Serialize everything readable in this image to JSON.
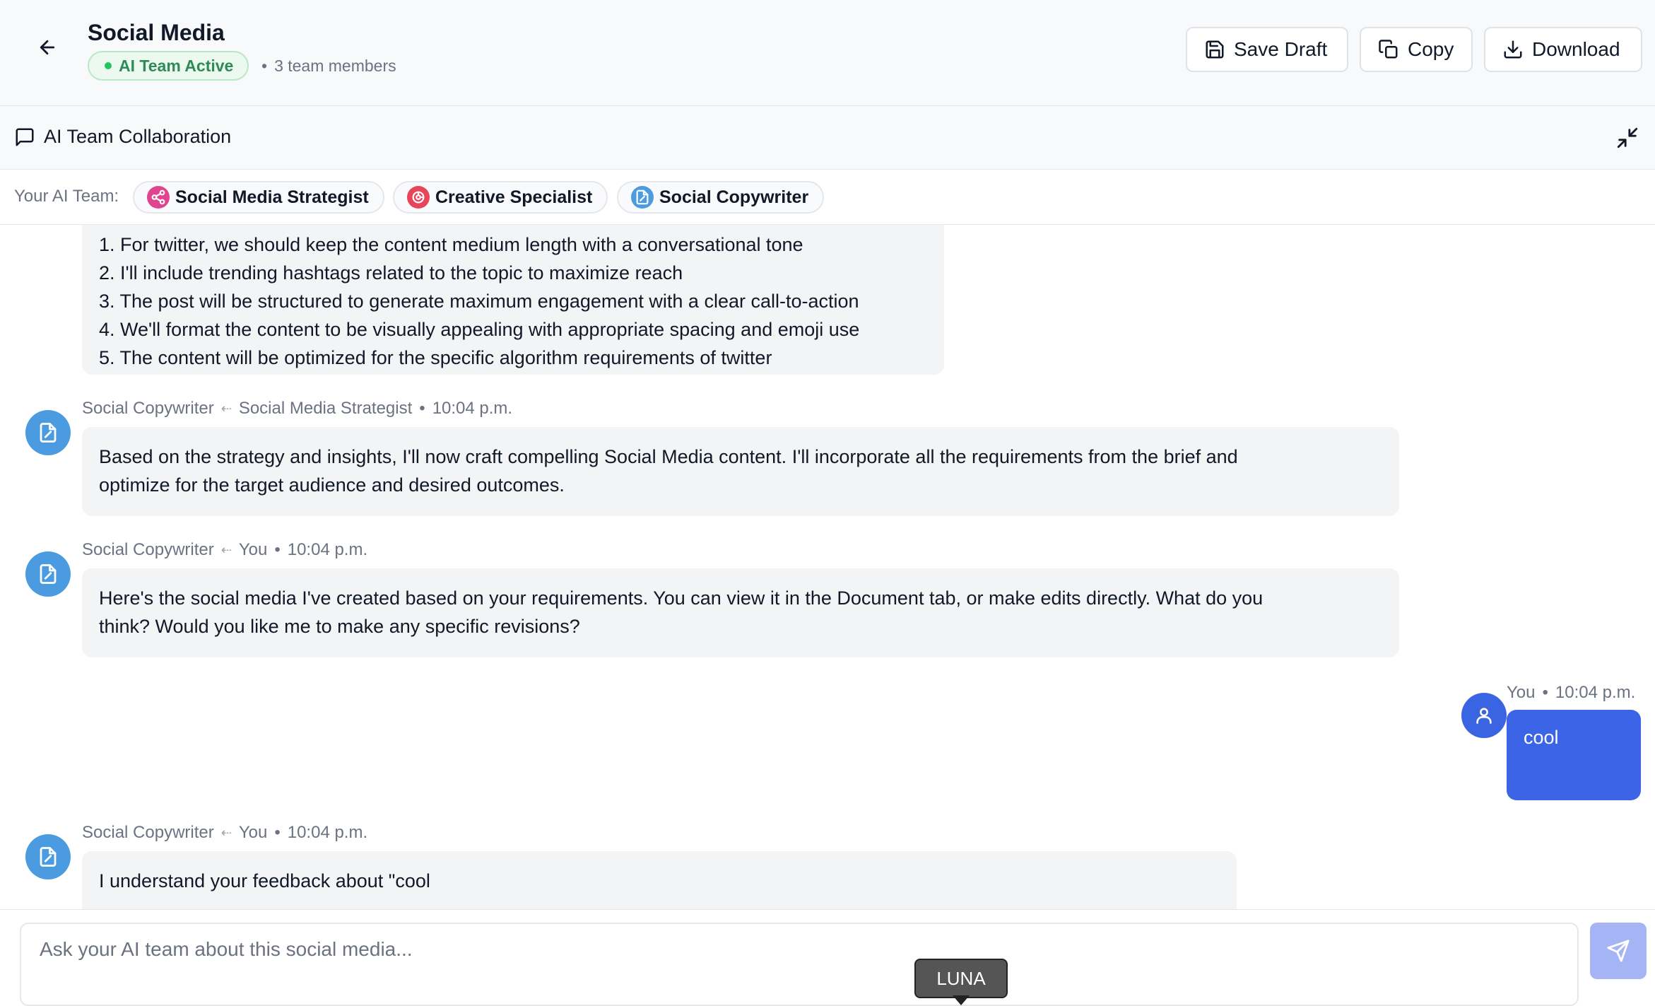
{
  "header": {
    "title": "Social Media",
    "status_badge": "AI Team Active",
    "separator": "•",
    "members": "3 team members",
    "save_label": "Save Draft",
    "copy_label": "Copy",
    "download_label": "Download"
  },
  "collaboration": {
    "title": "AI Team Collaboration"
  },
  "team": {
    "label": "Your AI Team:",
    "members": [
      {
        "name": "Social Media Strategist",
        "color": "#e0468f"
      },
      {
        "name": "Creative Specialist",
        "color": "#e8455a"
      },
      {
        "name": "Social Copywriter",
        "color": "#4b9be0"
      }
    ]
  },
  "messages": [
    {
      "lines": [
        "1. For twitter, we should keep the content medium length with a conversational tone",
        "2. I'll include trending hashtags related to the topic to maximize reach",
        "3. The post will be structured to generate maximum engagement with a clear call-to-action",
        "4. We'll format the content to be visually appealing with appropriate spacing and emoji use",
        "5. The content will be optimized for the specific algorithm requirements of twitter"
      ]
    },
    {
      "from": "Social Copywriter",
      "to": "Social Media Strategist",
      "time": "10:04 p.m.",
      "lines": [
        "Based on the strategy and insights, I'll now craft compelling Social Media content. I'll incorporate all the requirements from the brief and",
        "optimize for the target audience and desired outcomes."
      ]
    },
    {
      "from": "Social Copywriter",
      "to": "You",
      "time": "10:04 p.m.",
      "lines": [
        "Here's the social media I've created based on your requirements. You can view it in the Document tab, or make edits directly. What do you",
        "think? Would you like me to make any specific revisions?"
      ]
    },
    {
      "from": "You",
      "time": "10:04 p.m.",
      "text": "cool"
    },
    {
      "from": "Social Copywriter",
      "to": "You",
      "time": "10:04 p.m.",
      "lines": [
        "I understand your feedback about \"cool"
      ]
    }
  ],
  "meta_arrow": "⇠",
  "meta_dot": "•",
  "input": {
    "placeholder": "Ask your AI team about this social media..."
  },
  "tooltip": "LUNA",
  "colors": {
    "accent": "#3b64e6",
    "active_green": "#2e8b57",
    "agent_avatar": "#4b9be0"
  }
}
